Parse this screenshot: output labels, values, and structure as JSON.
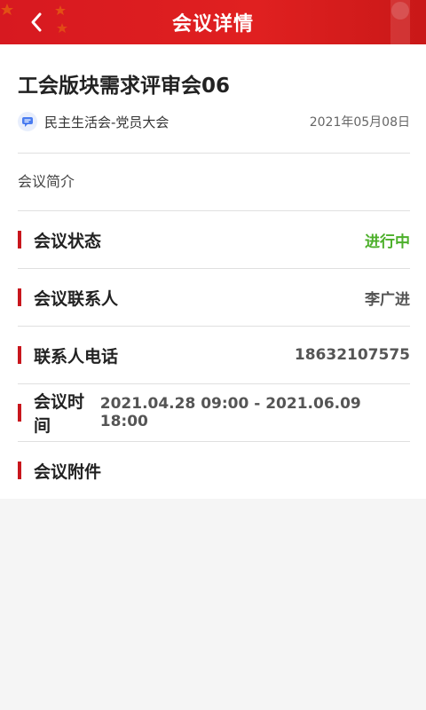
{
  "header": {
    "title": "会议详情",
    "back_icon": "chevron-left-icon",
    "background_color": "#d71920"
  },
  "meeting": {
    "topic": "工会版块需求评审会06",
    "category": "民主生活会-党员大会",
    "category_icon": "chat-icon",
    "date": "2021年05月08日",
    "intro_label": "会议简介"
  },
  "details": [
    {
      "label": "会议状态",
      "value": "进行中",
      "value_color": "#4caf2a"
    },
    {
      "label": "会议联系人",
      "value": "李广进"
    },
    {
      "label": "联系人电话",
      "value": "18632107575"
    },
    {
      "label": "会议时间",
      "value": "2021.04.28 09:00 - 2021.06.09 18:00"
    },
    {
      "label": "会议附件",
      "value": ""
    }
  ],
  "accent_color": "#c8161d"
}
